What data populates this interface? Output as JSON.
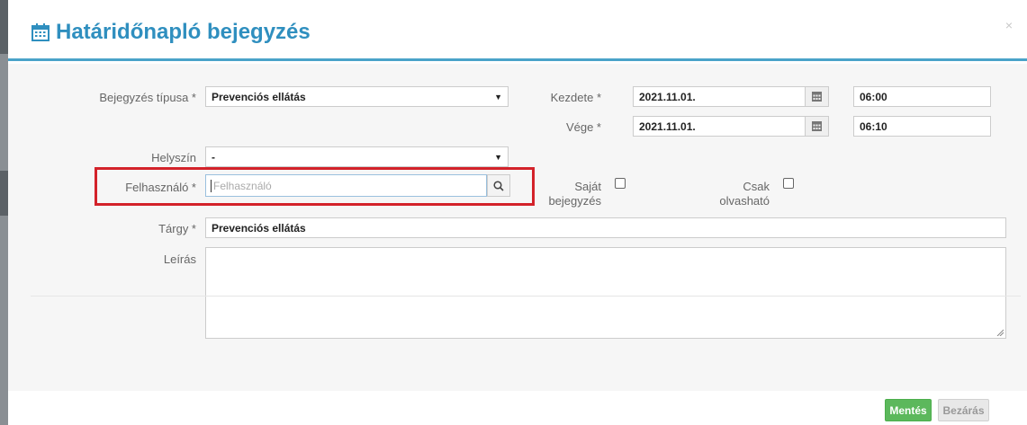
{
  "dialog": {
    "title": "Határidőnapló bejegyzés",
    "close_symbol": "×",
    "title_icon": "calendar-icon"
  },
  "form": {
    "entry_type": {
      "label": "Bejegyzés típusa *",
      "value": "Prevenciós ellátás"
    },
    "start": {
      "label": "Kezdete *",
      "date": "2021.11.01.",
      "time": "06:00"
    },
    "end": {
      "label": "Vége *",
      "date": "2021.11.01.",
      "time": "06:10"
    },
    "location": {
      "label": "Helyszín",
      "value": "-"
    },
    "user": {
      "label": "Felhasználó *",
      "placeholder": "Felhasználó",
      "value": ""
    },
    "own_entry": {
      "label_line1": "Saját",
      "label_line2": "bejegyzés",
      "checked": false
    },
    "read_only": {
      "label_line1": "Csak",
      "label_line2": "olvasható",
      "checked": false
    },
    "subject": {
      "label": "Tárgy *",
      "value": "Prevenciós ellátás"
    },
    "description": {
      "label": "Leírás",
      "value": ""
    }
  },
  "footer": {
    "save_label": "Mentés",
    "close_label": "Bezárás"
  },
  "colors": {
    "title": "#2f8fbf",
    "header_rule": "#4aa3c9",
    "save_button": "#5cb85c",
    "highlight_box": "#d3222a"
  }
}
